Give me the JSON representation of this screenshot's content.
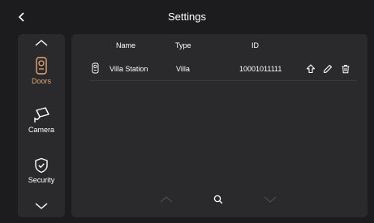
{
  "header": {
    "title": "Settings"
  },
  "sidebar": {
    "items": [
      {
        "label": "Doors",
        "icon": "door-station-icon",
        "active": true
      },
      {
        "label": "Camera",
        "icon": "camera-icon",
        "active": false
      },
      {
        "label": "Security",
        "icon": "shield-check-icon",
        "active": false
      }
    ]
  },
  "table": {
    "columns": [
      "Name",
      "Type",
      "ID"
    ],
    "rows": [
      {
        "icon": "door-station-icon",
        "name": "Villa Station",
        "type": "Villa",
        "id": "10001011111",
        "actions": [
          "upload-icon",
          "edit-icon",
          "delete-icon"
        ]
      }
    ]
  },
  "footer": {
    "icons": [
      "chevron-up-icon",
      "search-icon",
      "chevron-down-icon"
    ]
  },
  "colors": {
    "background": "#1c1c1e",
    "panel": "#2a2a2c",
    "accent": "#e3a777",
    "text": "#ffffff",
    "muted": "#4a4a4c"
  }
}
